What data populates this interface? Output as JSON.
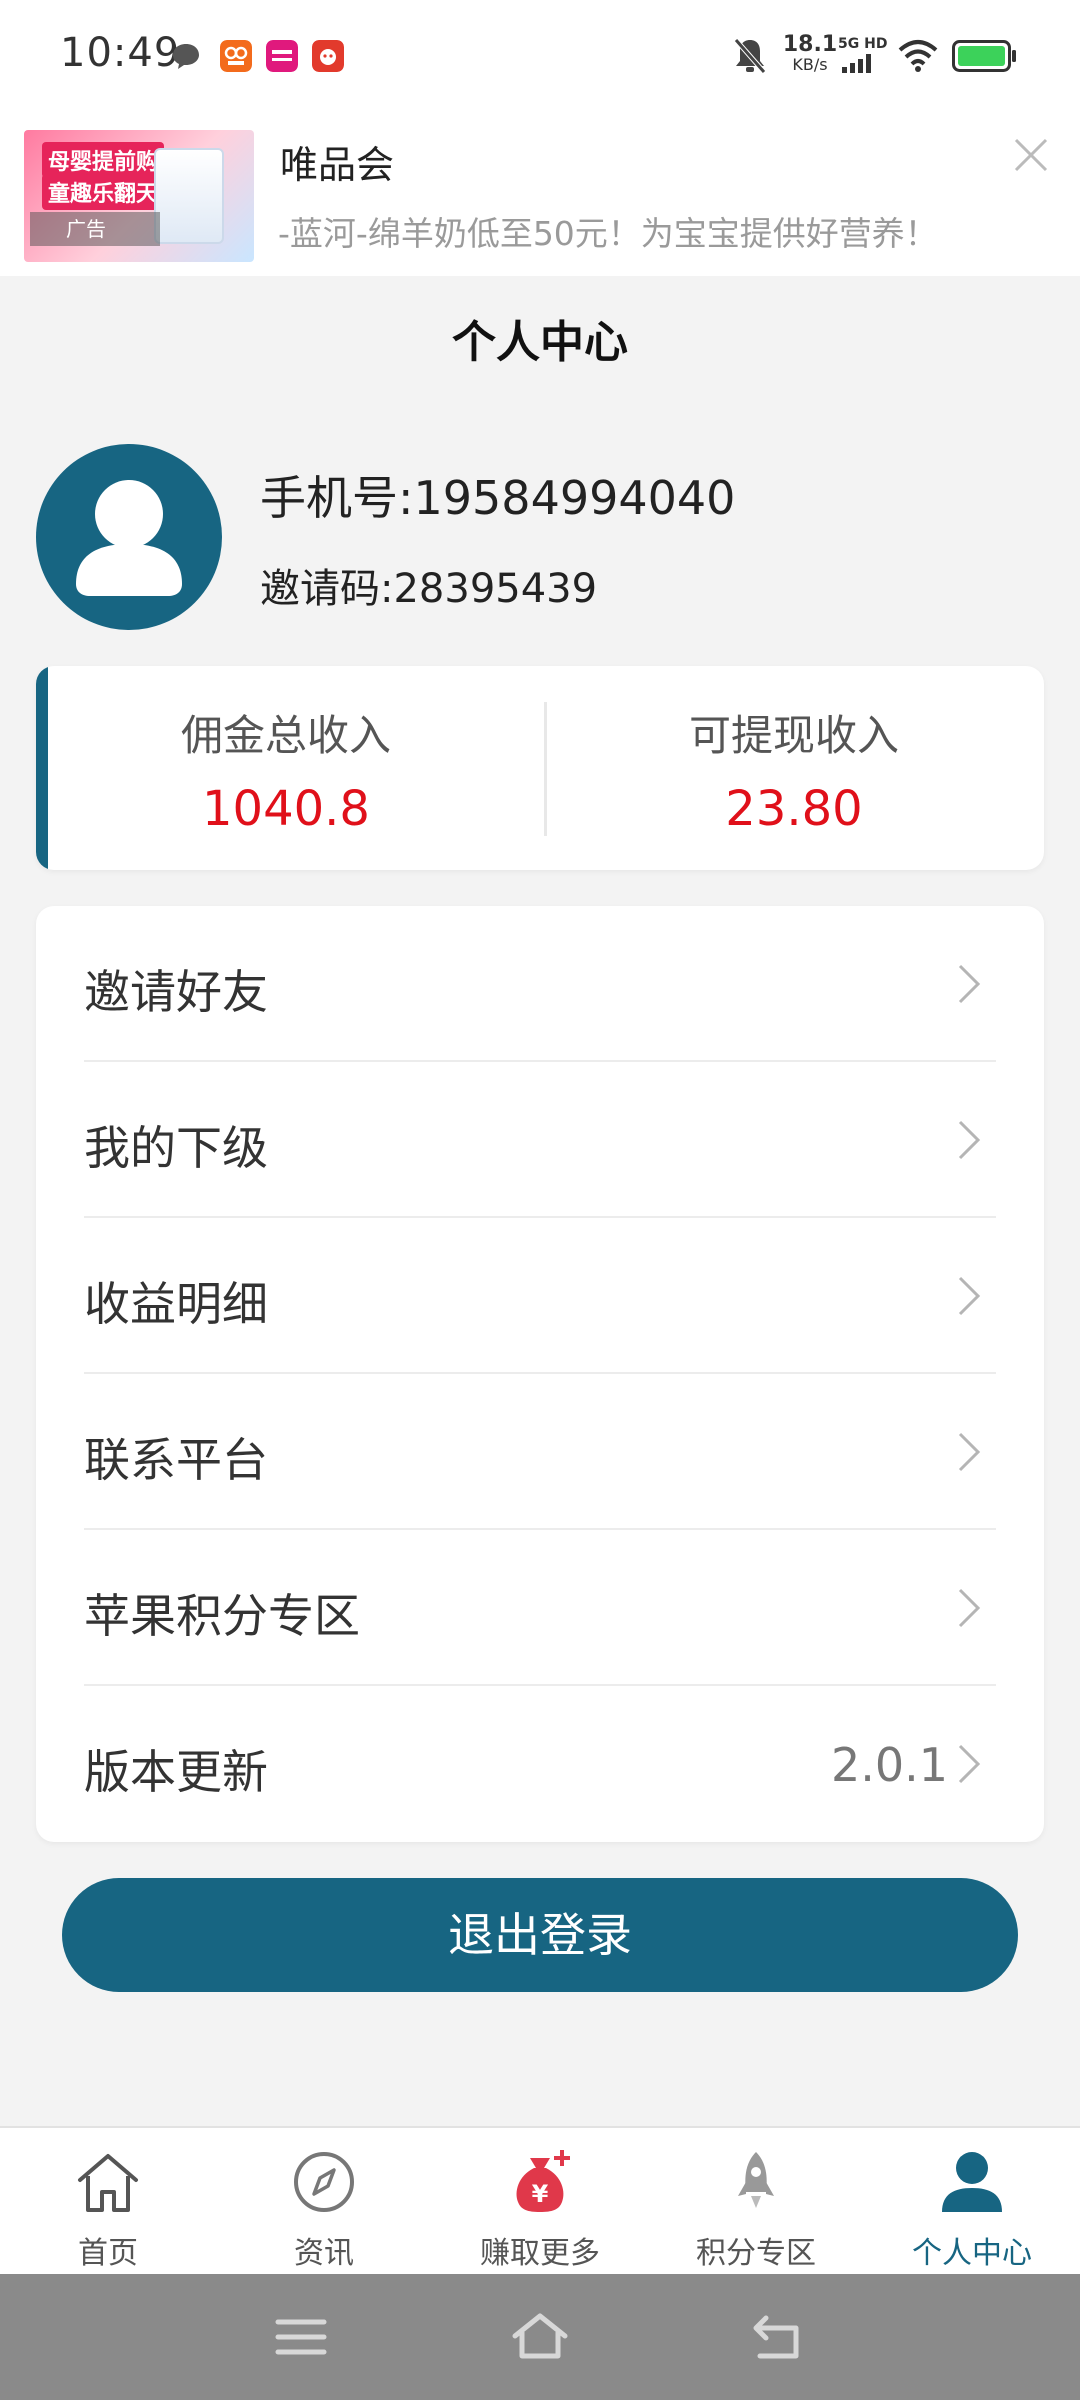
{
  "status_bar": {
    "time": "10:49",
    "net_speed_value": "18.1",
    "net_speed_unit": "KB/s",
    "network_label": "5G HD",
    "app_icons": [
      "chat-bubble-icon",
      "app-orange-icon",
      "vipshop-icon",
      "app-red-icon"
    ]
  },
  "ad": {
    "title": "唯品会",
    "description": "-蓝河-绵羊奶低至50元！为宝宝提供好营养！",
    "label": "广告",
    "promo_line1": "母婴提前购",
    "promo_line2": "童趣乐翻天"
  },
  "header": {
    "title": "个人中心"
  },
  "profile": {
    "phone": "手机号:19584994040",
    "invite_code": "邀请码:28395439"
  },
  "income": {
    "total_label": "佣金总收入",
    "total_value": "1040.8",
    "withdrawable_label": "可提现收入",
    "withdrawable_value": "23.80"
  },
  "menu": [
    {
      "label": "邀请好友",
      "value": ""
    },
    {
      "label": "我的下级",
      "value": ""
    },
    {
      "label": "收益明细",
      "value": ""
    },
    {
      "label": "联系平台",
      "value": ""
    },
    {
      "label": "苹果积分专区",
      "value": ""
    },
    {
      "label": "版本更新",
      "value": "2.0.1"
    }
  ],
  "logout_label": "退出登录",
  "tabs": [
    {
      "label": "首页",
      "icon": "home-icon",
      "active": false
    },
    {
      "label": "资讯",
      "icon": "compass-icon",
      "active": false
    },
    {
      "label": "赚取更多",
      "icon": "money-bag-icon",
      "active": false
    },
    {
      "label": "积分专区",
      "icon": "rocket-icon",
      "active": false
    },
    {
      "label": "个人中心",
      "icon": "person-icon",
      "active": true
    }
  ],
  "colors": {
    "accent": "#176582",
    "income_value": "#e0101a",
    "background": "#f3f3f3"
  }
}
